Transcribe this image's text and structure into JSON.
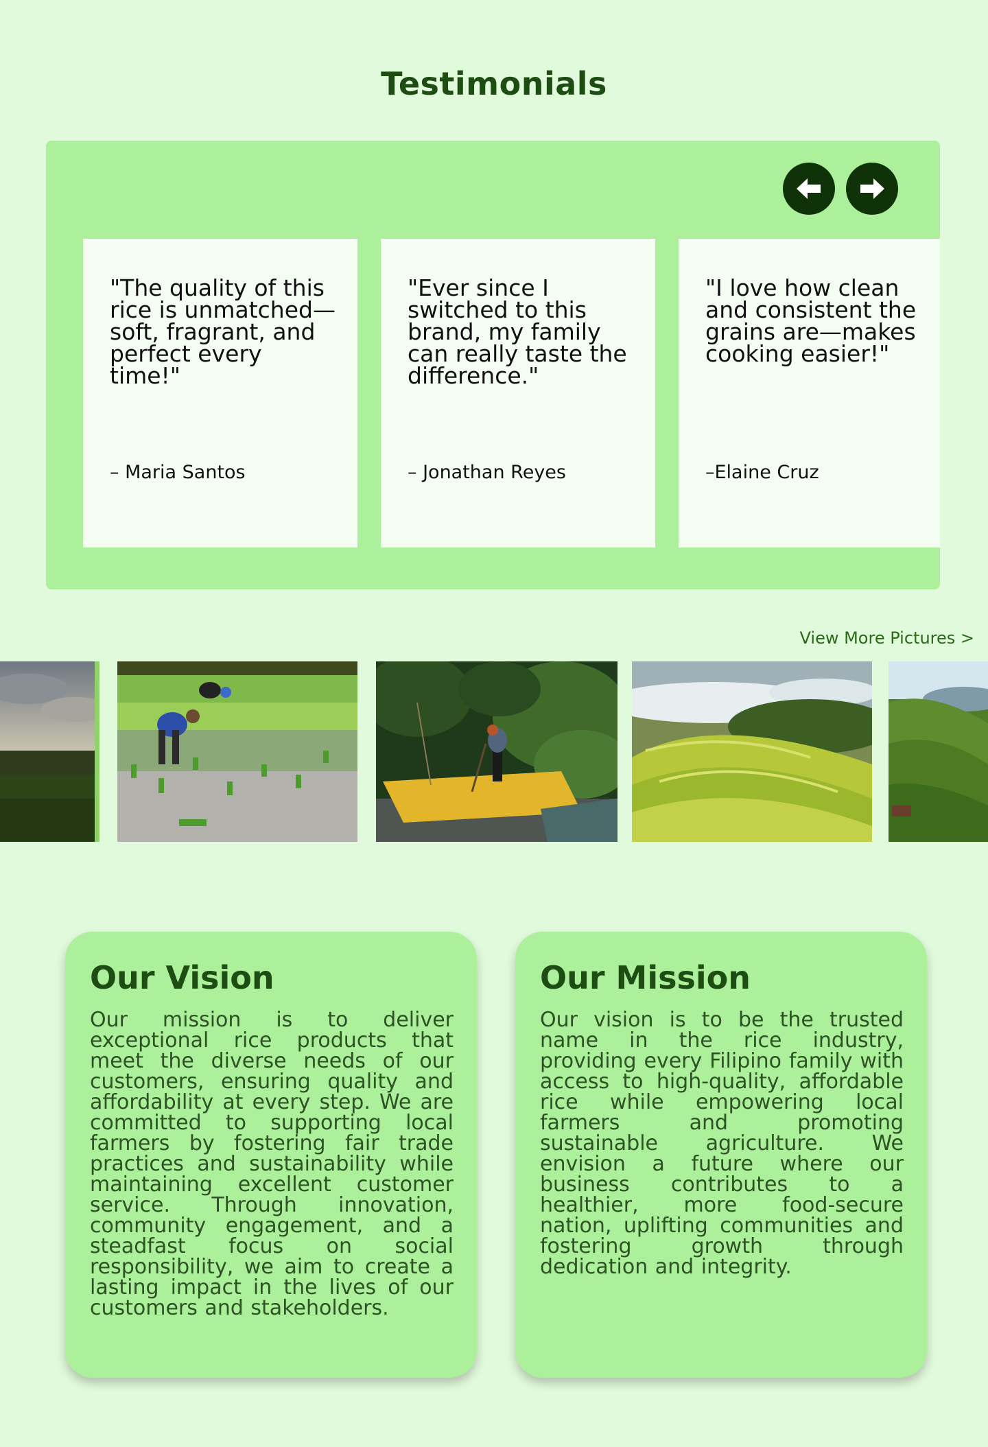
{
  "testimonials": {
    "title": "Testimonials",
    "prev_label": "Previous",
    "next_label": "Next",
    "items": [
      {
        "quote": "\"The quality of this rice is unmatched—soft, fragrant, and perfect every time!\"",
        "author": "– Maria Santos"
      },
      {
        "quote": "\"Ever since I switched to this brand, my family can really taste the difference.\"",
        "author": "– Jonathan Reyes"
      },
      {
        "quote": "\"I love how clean and consistent the grains are—makes cooking easier!\"",
        "author": "–Elaine Cruz"
      }
    ]
  },
  "gallery": {
    "view_more": "View More Pictures >",
    "photos": [
      "sunset-rice-field",
      "farmers-planting-rice",
      "farmer-drying-rice",
      "rice-terraces-valley",
      "rice-terraces-mountain"
    ]
  },
  "vision": {
    "title": "Our Vision",
    "text": "Our mission is to deliver exceptional rice products that meet the diverse needs of our customers, ensuring quality and affordability at every step. We are committed to supporting local farmers by fostering fair trade practices and sustainability while maintaining excellent customer service. Through innovation, community engagement, and a steadfast focus on social responsibility, we aim to create a lasting impact in the lives of our customers and stakeholders."
  },
  "mission": {
    "title": "Our Mission",
    "text": "Our vision is to be the trusted name in the rice industry, providing every Filipino family with access to high-quality, affordable rice while empowering local farmers and promoting sustainable agriculture. We envision a future where our business contributes to a healthier, more food-secure nation, uplifting communities and fostering growth through dedication and integrity."
  },
  "colors": {
    "background": "#e1fadb",
    "panel": "#acf09b",
    "card": "#f3fdf1",
    "heading": "#1d4d12",
    "button": "#0f3209",
    "link": "#276b17"
  }
}
